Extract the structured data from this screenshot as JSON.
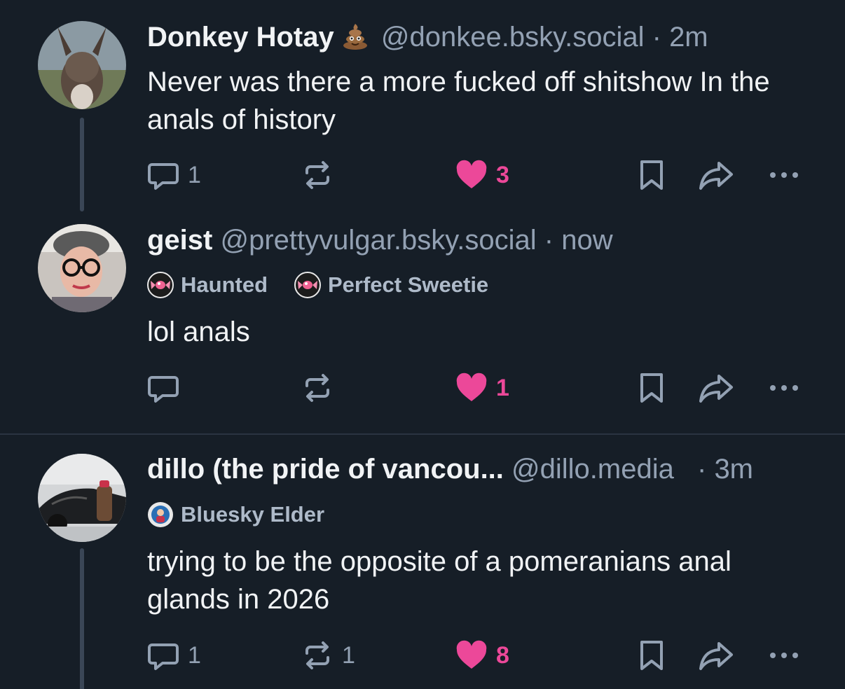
{
  "colors": {
    "background": "#161e27",
    "text": "#f1f3f5",
    "muted": "#93a1b3",
    "like": "#ec4899",
    "thread_line": "#3a4656"
  },
  "posts": [
    {
      "display_name": "Donkey Hotay",
      "name_emoji": "💩",
      "handle": "@donkee.bsky.social",
      "separator": "·",
      "time": "2m",
      "badges": [],
      "text": "Never was there a more fucked off shitshow In the anals of history",
      "reply_count": "1",
      "repost_count": "",
      "like_count": "3",
      "liked": true
    },
    {
      "display_name": "geist",
      "handle": "@prettyvulgar.bsky.social",
      "separator": "·",
      "time": "now",
      "badges": [
        {
          "label": "Haunted",
          "icon": "candy-badge-icon"
        },
        {
          "label": "Perfect Sweetie",
          "icon": "candy-badge-icon"
        }
      ],
      "text": "lol anals",
      "reply_count": "",
      "repost_count": "",
      "like_count": "1",
      "liked": true
    },
    {
      "display_name": "dillo (the pride of vancou...",
      "handle": "@dillo.media",
      "separator": "·",
      "time": "3m",
      "badges": [
        {
          "label": "Bluesky Elder",
          "icon": "elder-badge-icon"
        }
      ],
      "text": "trying to be the opposite of a pomeranians anal glands in 2026",
      "reply_count": "1",
      "repost_count": "1",
      "like_count": "8",
      "liked": true
    }
  ]
}
